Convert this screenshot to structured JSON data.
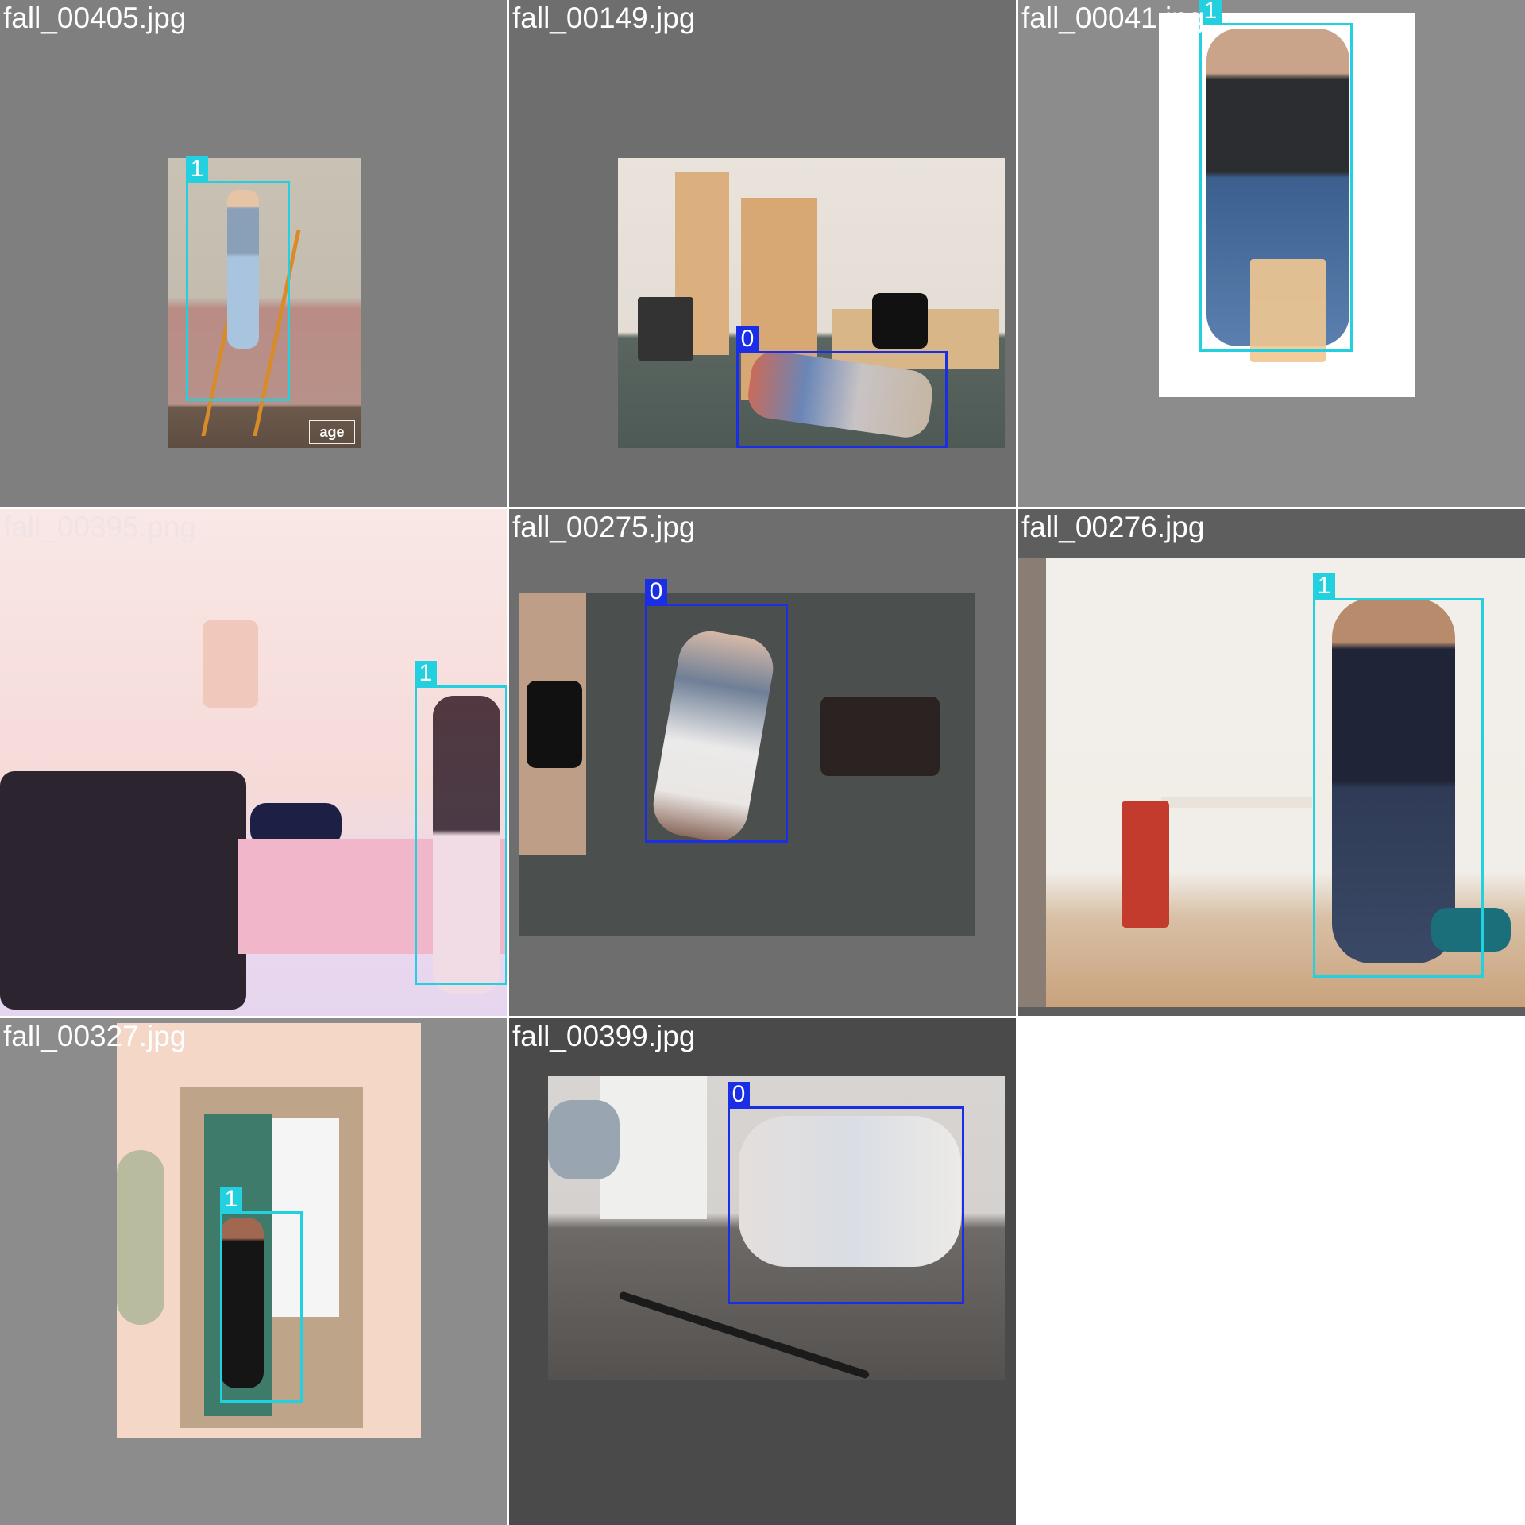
{
  "colors": {
    "class_0": "#1a2ee6",
    "class_1": "#22d0e0",
    "tile_bg_light": "#8c8c8c",
    "tile_bg_mid": "#6e6e6e",
    "tile_bg_dark": "#4a4a4a"
  },
  "tiles": [
    {
      "file": "fall_00405.jpg",
      "boxes": [
        {
          "cls": "1"
        }
      ]
    },
    {
      "file": "fall_00149.jpg",
      "boxes": [
        {
          "cls": "0"
        }
      ]
    },
    {
      "file": "fall_00041.jpg",
      "boxes": [
        {
          "cls": "1"
        }
      ]
    },
    {
      "file": "fall_00395.png",
      "boxes": [
        {
          "cls": "1"
        }
      ]
    },
    {
      "file": "fall_00275.jpg",
      "boxes": [
        {
          "cls": "0"
        }
      ]
    },
    {
      "file": "fall_00276.jpg",
      "boxes": [
        {
          "cls": "1"
        }
      ]
    },
    {
      "file": "fall_00327.jpg",
      "boxes": [
        {
          "cls": "1"
        }
      ]
    },
    {
      "file": "fall_00399.jpg",
      "boxes": [
        {
          "cls": "0"
        }
      ]
    }
  ]
}
